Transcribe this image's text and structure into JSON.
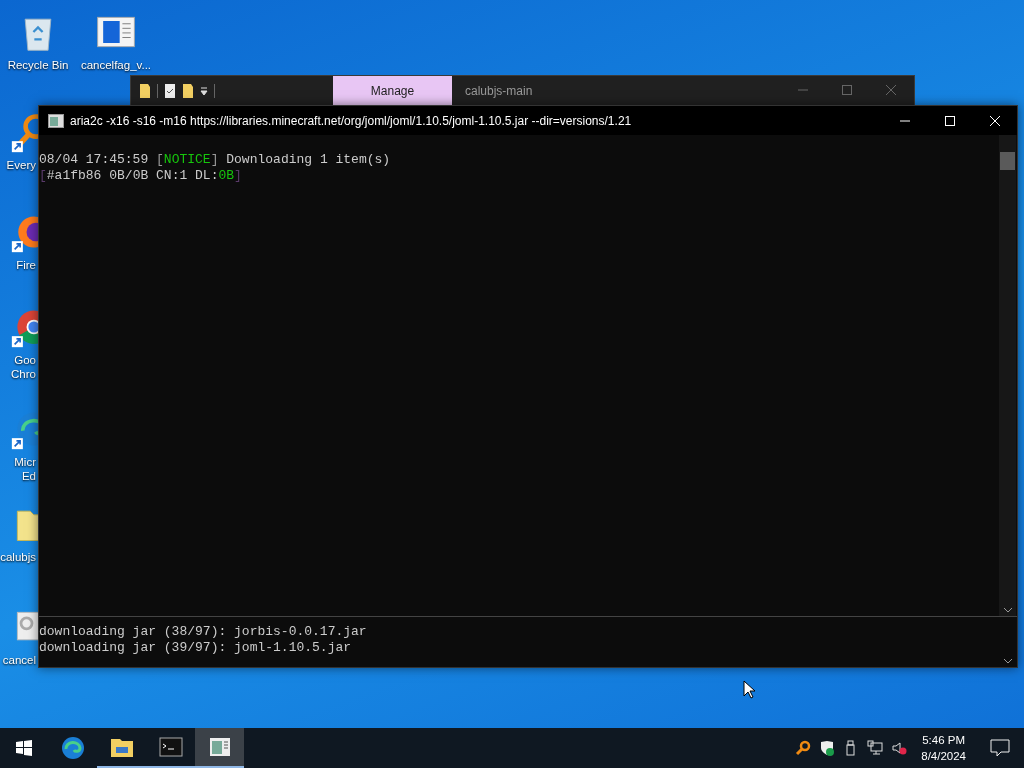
{
  "desktop_icons": [
    {
      "kind": "recycle-bin",
      "shortcut": false,
      "label_lines": [
        "Recycle Bin"
      ]
    },
    {
      "kind": "document",
      "shortcut": false,
      "label_lines": [
        "cancelfag_v..."
      ]
    },
    {
      "kind": "magnifier",
      "shortcut": true,
      "label_lines": [
        "Every"
      ]
    },
    {
      "kind": "firefox",
      "shortcut": true,
      "label_lines": [
        "Fire"
      ]
    },
    {
      "kind": "chrome",
      "shortcut": true,
      "label_lines": [
        "Goo",
        "Chro"
      ]
    },
    {
      "kind": "edge",
      "shortcut": true,
      "label_lines": [
        "Micr",
        "Ed"
      ]
    },
    {
      "kind": "folder",
      "shortcut": false,
      "label_lines": [
        "calubjs"
      ]
    },
    {
      "kind": "gear-doc",
      "shortcut": false,
      "label_lines": [
        "cancel"
      ]
    }
  ],
  "explorer_window": {
    "ribbon_tab": "Manage",
    "title": "calubjs-main"
  },
  "console_window": {
    "title": "aria2c  -x16 -s16 -m16 https://libraries.minecraft.net/org/joml/joml/1.10.5/joml-1.10.5.jar --dir=versions/1.21",
    "lines": [
      [
        {
          "kind": "normal",
          "text": "08/04 17:45:59 "
        },
        {
          "kind": "bracket-light",
          "text": "["
        },
        {
          "kind": "green",
          "text": "NOTICE"
        },
        {
          "kind": "bracket-light",
          "text": "]"
        },
        {
          "kind": "normal",
          "text": " Downloading 1 item(s)"
        }
      ],
      [
        {
          "kind": "bracket-dark",
          "text": "["
        },
        {
          "kind": "normal",
          "text": "#a1fb86 0B/0B CN:1 DL:"
        },
        {
          "kind": "green",
          "text": "0B"
        },
        {
          "kind": "bracket-dark",
          "text": "]"
        }
      ]
    ],
    "lower_lines": [
      "downloading jar (38/97): jorbis-0.0.17.jar",
      "downloading jar (39/97): joml-1.10.5.jar"
    ]
  },
  "taskbar": {
    "apps": [
      {
        "kind": "edge",
        "running": false,
        "active": false
      },
      {
        "kind": "explorer",
        "running": true,
        "active": false
      },
      {
        "kind": "terminal",
        "running": true,
        "active": false
      },
      {
        "kind": "document",
        "running": true,
        "active": true
      }
    ],
    "clock_time": "5:46 PM",
    "clock_date": "8/4/2024"
  }
}
